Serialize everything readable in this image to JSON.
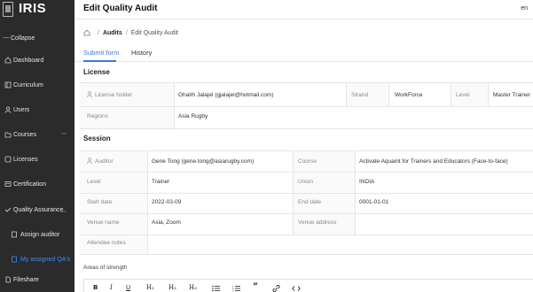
{
  "brand": {
    "name": "IRIS"
  },
  "header": {
    "title": "Edit Quality Audit",
    "lang": "en"
  },
  "sidebar": {
    "collapse_label": "Collapse",
    "items": [
      {
        "label": "Dashboard",
        "icon": "home-icon"
      },
      {
        "label": "Curriculum",
        "icon": "book-icon"
      },
      {
        "label": "Users",
        "icon": "user-icon"
      },
      {
        "label": "Courses",
        "icon": "folder-icon",
        "chevron": "﹀"
      },
      {
        "label": "Licenses",
        "icon": "license-icon"
      },
      {
        "label": "Certification",
        "icon": "certificate-icon"
      },
      {
        "label": "Quality Assurance",
        "icon": "checklist-icon",
        "chevron": "︿"
      },
      {
        "label": "Assign auditor",
        "icon": "assign-icon"
      },
      {
        "label": "My assigned QA's",
        "icon": "assigned-icon",
        "active": true
      },
      {
        "label": "Fileshare",
        "icon": "file-icon"
      }
    ]
  },
  "breadcrumb": {
    "section": "Audits",
    "current": "Edit Quality Audit",
    "separator": "/"
  },
  "tabs": [
    {
      "label": "Submit form",
      "active": true
    },
    {
      "label": "History"
    }
  ],
  "license": {
    "title": "License",
    "holder_label": "License holder",
    "holder_value": "Ghaith Jalajel (gjalajel@hotmail.com)",
    "strand_label": "Strand",
    "strand_value": "WorkForce",
    "level_label": "Level",
    "level_value": "Master Trainer",
    "regions_label": "Regions",
    "regions_value": "Asia Rugby"
  },
  "session": {
    "title": "Session",
    "auditor_label": "Auditor",
    "auditor_value": "Gene Tong (gene.tong@asiarugby.com)",
    "course_label": "Course",
    "course_value": "Activate Aquaint for Trainers and Educators (Face-to-face)",
    "level_label": "Level",
    "level_value": "Trainer",
    "union_label": "Union",
    "union_value": "INDIA",
    "start_label": "Start date",
    "start_value": "2022-03-09",
    "end_label": "End date",
    "end_value": "0001-01-01",
    "venue_label": "Venue name",
    "venue_value": "Asia, Zoom",
    "venue_address_label": "Venue address",
    "venue_address_value": "",
    "attendee_label": "Attendee notes",
    "attendee_value": ""
  },
  "areas": {
    "label": "Areas of strength"
  },
  "toolbar": {
    "bold": "B",
    "italic": "I",
    "underline": "U",
    "h1": "H₁",
    "h2": "H₂",
    "h3": "H₃",
    "quote": "”"
  },
  "colors": {
    "sidebar_bg": "#2b2b2b",
    "accent": "#3d7bd9",
    "active_link": "#3d8bfd"
  }
}
